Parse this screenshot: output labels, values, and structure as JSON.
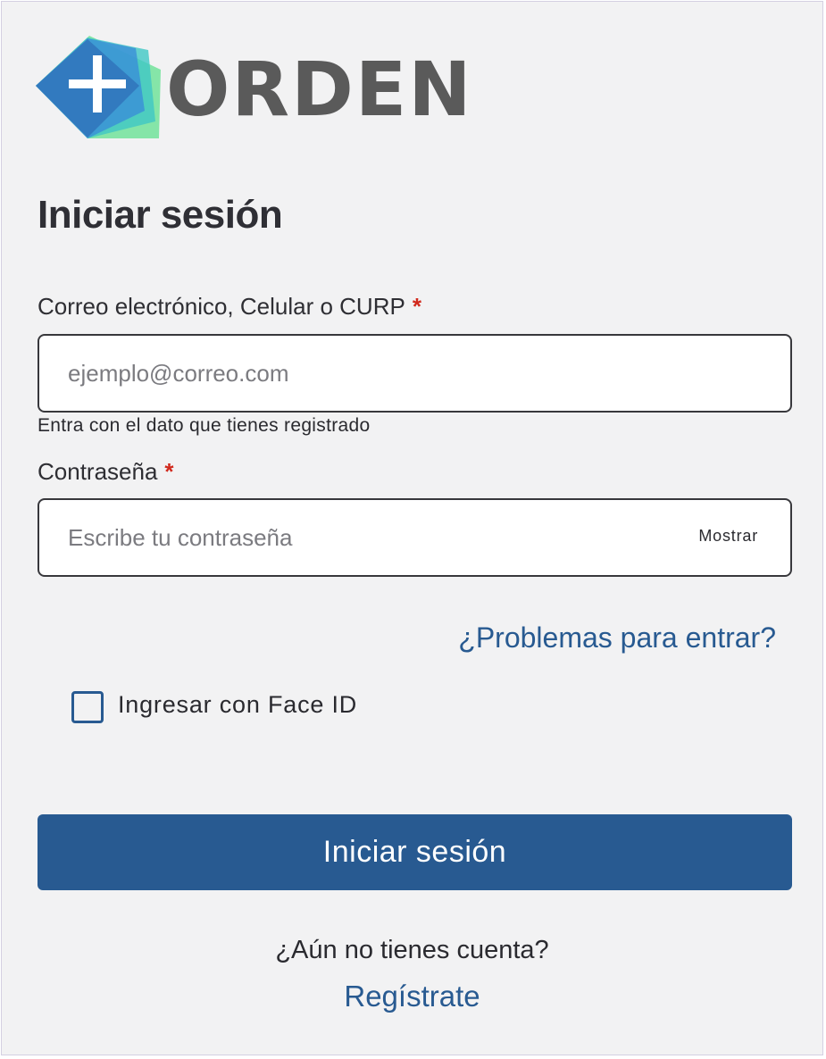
{
  "brand": {
    "name": "ORDEN",
    "logo_icon": "plus-squares-icon",
    "colors": {
      "wordmark": "#5a5a5a",
      "accent": "#285a91",
      "logo_blue": "#3a8fd8",
      "logo_teal": "#3fc7c4",
      "logo_green": "#72e39a"
    }
  },
  "login": {
    "title": "Iniciar sesión",
    "email": {
      "label": "Correo electrónico, Celular o CURP",
      "required_mark": "*",
      "placeholder": "ejemplo@correo.com",
      "value": "",
      "help": "Entra con el dato que tienes registrado"
    },
    "password": {
      "label": "Contraseña",
      "required_mark": "*",
      "placeholder": "Escribe tu contraseña",
      "value": "",
      "show_label": "Mostrar"
    },
    "trouble_link": "¿Problemas para entrar?",
    "face_id": {
      "label": "Ingresar con Face ID",
      "checked": false
    },
    "submit_label": "Iniciar sesión",
    "no_account_text": "¿Aún no tienes cuenta?",
    "register_link": "Regístrate"
  }
}
